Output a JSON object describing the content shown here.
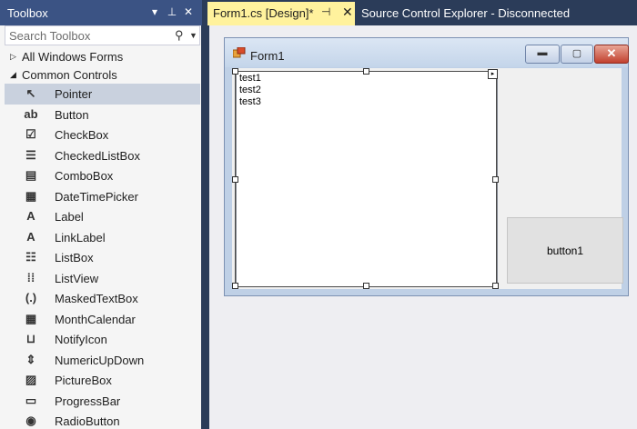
{
  "toolbox": {
    "title": "Toolbox",
    "dropdown_glyph": "▾",
    "pin_glyph": "⊥",
    "close_glyph": "✕",
    "search": {
      "placeholder": "Search Toolbox",
      "value": ""
    },
    "categories": [
      {
        "label": "All Windows Forms",
        "expanded": false
      },
      {
        "label": "Common Controls",
        "expanded": true
      }
    ],
    "items": [
      {
        "label": "Pointer",
        "icon": "pointer-icon",
        "glyph": "↖",
        "selected": true
      },
      {
        "label": "Button",
        "icon": "button-icon",
        "glyph": "ab"
      },
      {
        "label": "CheckBox",
        "icon": "checkbox-icon",
        "glyph": "☑"
      },
      {
        "label": "CheckedListBox",
        "icon": "checked-list-icon",
        "glyph": "☰"
      },
      {
        "label": "ComboBox",
        "icon": "combobox-icon",
        "glyph": "▤"
      },
      {
        "label": "DateTimePicker",
        "icon": "calendar-icon",
        "glyph": "▦"
      },
      {
        "label": "Label",
        "icon": "label-icon",
        "glyph": "A"
      },
      {
        "label": "LinkLabel",
        "icon": "link-label-icon",
        "glyph": "A"
      },
      {
        "label": "ListBox",
        "icon": "listbox-icon",
        "glyph": "☷"
      },
      {
        "label": "ListView",
        "icon": "listview-icon",
        "glyph": "⁞⁞"
      },
      {
        "label": "MaskedTextBox",
        "icon": "masked-text-icon",
        "glyph": "(.)"
      },
      {
        "label": "MonthCalendar",
        "icon": "month-calendar-icon",
        "glyph": "▦"
      },
      {
        "label": "NotifyIcon",
        "icon": "notify-icon",
        "glyph": "⊔"
      },
      {
        "label": "NumericUpDown",
        "icon": "numeric-updown-icon",
        "glyph": "⇕"
      },
      {
        "label": "PictureBox",
        "icon": "picture-icon",
        "glyph": "▨"
      },
      {
        "label": "ProgressBar",
        "icon": "progress-bar-icon",
        "glyph": "▭"
      },
      {
        "label": "RadioButton",
        "icon": "radio-icon",
        "glyph": "◉"
      }
    ]
  },
  "tabs": {
    "active": {
      "label": "Form1.cs [Design]*",
      "pin_glyph": "⊣",
      "close_glyph": "✕"
    },
    "inactive": {
      "label": "Source Control Explorer - Disconnected"
    }
  },
  "form": {
    "title": "Form1",
    "minimize_glyph": "▬",
    "maximize_glyph": "▢",
    "close_glyph": "✕",
    "listbox_items": [
      "test1",
      "test2",
      "test3"
    ],
    "smart_tag_glyph": "▸",
    "button1_label": "button1"
  },
  "colors": {
    "accent_header": "#3b5384",
    "tab_active": "#fff29d",
    "selection": "#c9d1de"
  }
}
